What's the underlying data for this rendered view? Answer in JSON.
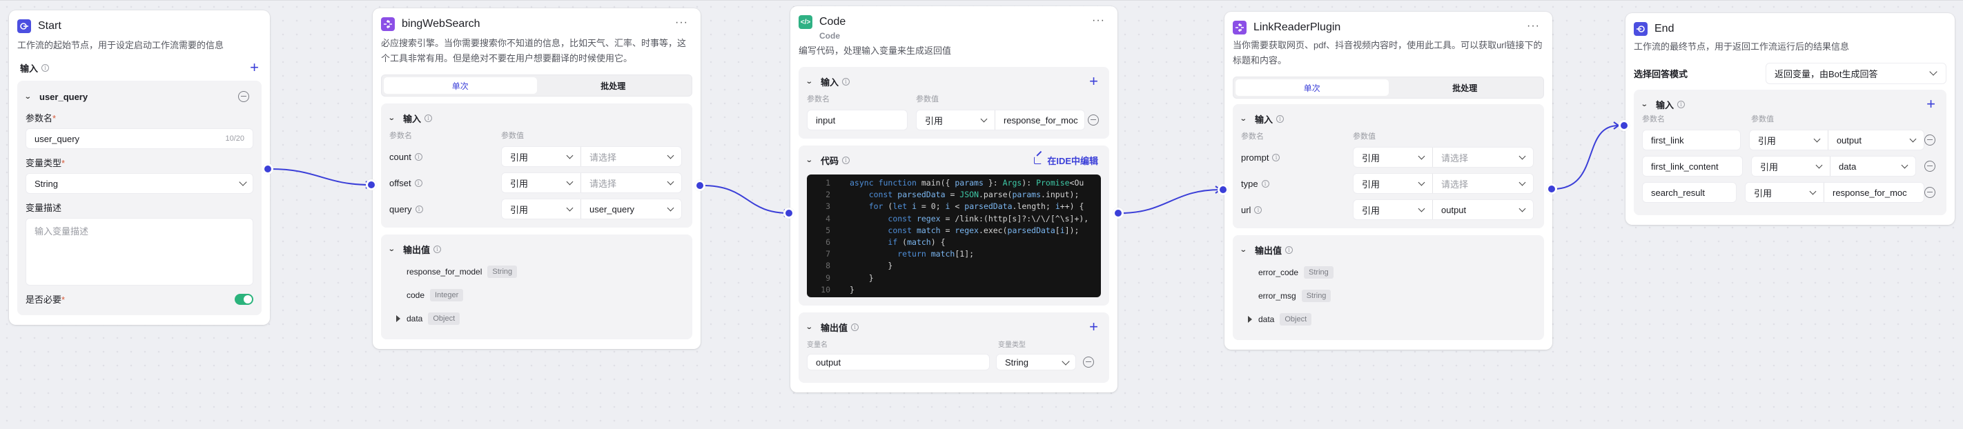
{
  "nodes": {
    "start": {
      "title": "Start",
      "description": "工作流的起始节点，用于设定启动工作流需要的信息",
      "input_label": "输入",
      "param": {
        "name": "user_query",
        "name_label": "参数名",
        "name_value": "user_query",
        "name_counter": "10/20",
        "type_label": "变量类型",
        "type_value": "String",
        "desc_label": "变量描述",
        "desc_placeholder": "输入变量描述",
        "required_label": "是否必要",
        "required": true
      }
    },
    "bing": {
      "title": "bingWebSearch",
      "description": "必应搜索引擎。当你需要搜索你不知道的信息，比如天气、汇率、时事等，这个工具非常有用。但是绝对不要在用户想要翻译的时候使用它。",
      "tabs": [
        "单次",
        "批处理"
      ],
      "active_tab": "单次",
      "input_label": "输入",
      "col_name": "参数名",
      "col_value": "参数值",
      "inputs": [
        {
          "name": "count",
          "mode": "引用",
          "value": "请选择",
          "placeholder": true
        },
        {
          "name": "offset",
          "mode": "引用",
          "value": "请选择",
          "placeholder": true
        },
        {
          "name": "query",
          "mode": "引用",
          "value": "user_query",
          "placeholder": false
        }
      ],
      "output_label": "输出值",
      "outputs": [
        {
          "name": "response_for_model",
          "type": "String",
          "expandable": false
        },
        {
          "name": "code",
          "type": "Integer",
          "expandable": false
        },
        {
          "name": "data",
          "type": "Object",
          "expandable": true
        }
      ]
    },
    "code": {
      "title": "Code",
      "subtitle": "Code",
      "description": "编写代码，处理输入变量来生成返回值",
      "input_label": "输入",
      "col_name": "参数名",
      "col_value": "参数值",
      "inputs": [
        {
          "name": "input",
          "mode": "引用",
          "value": "response_for_moc"
        }
      ],
      "code_label": "代码",
      "ide_link": "在IDE中编辑",
      "line_numbers": [
        "1",
        "2",
        "3",
        "4",
        "5",
        "6",
        "7",
        "8",
        "9",
        "10"
      ],
      "code_lines": [
        "async function main({ params }: Args): Promise<Ou",
        "    const parsedData = JSON.parse(params.input);",
        "    for (let i = 0; i < parsedData.length; i++) {",
        "        const regex = /link:(http[s]?:\\/\\/[^\\s]+),",
        "        const match = regex.exec(parsedData[i]);",
        "        if (match) {",
        "          return match[1];",
        "        }",
        "    }",
        "}"
      ],
      "output_label": "输出值",
      "out_col_name": "变量名",
      "out_col_type": "变量类型",
      "outputs": [
        {
          "name": "output",
          "type": "String"
        }
      ]
    },
    "linkreader": {
      "title": "LinkReaderPlugin",
      "description": "当你需要获取网页、pdf、抖音视频内容时，使用此工具。可以获取url链接下的标题和内容。",
      "tabs": [
        "单次",
        "批处理"
      ],
      "active_tab": "单次",
      "input_label": "输入",
      "col_name": "参数名",
      "col_value": "参数值",
      "inputs": [
        {
          "name": "prompt",
          "mode": "引用",
          "value": "请选择",
          "placeholder": true
        },
        {
          "name": "type",
          "mode": "引用",
          "value": "请选择",
          "placeholder": true
        },
        {
          "name": "url",
          "mode": "引用",
          "value": "output",
          "placeholder": false
        }
      ],
      "output_label": "输出值",
      "outputs": [
        {
          "name": "error_code",
          "type": "String",
          "expandable": false
        },
        {
          "name": "error_msg",
          "type": "String",
          "expandable": false
        },
        {
          "name": "data",
          "type": "Object",
          "expandable": true
        }
      ]
    },
    "end": {
      "title": "End",
      "description": "工作流的最终节点，用于返回工作流运行后的结果信息",
      "mode_label": "选择回答模式",
      "mode_value": "返回变量，由Bot生成回答",
      "input_label": "输入",
      "col_name": "参数名",
      "col_value": "参数值",
      "inputs": [
        {
          "name": "first_link",
          "mode": "引用",
          "value": "output"
        },
        {
          "name": "first_link_content",
          "mode": "引用",
          "value": "data"
        },
        {
          "name": "search_result",
          "mode": "引用",
          "value": "response_for_moc"
        }
      ]
    }
  },
  "colors": {
    "accent": "#3b3fd8",
    "start_icon": "#4c4fe0",
    "plugin_icon": "#8b4fe6",
    "code_icon": "#2fb184",
    "toggle_on": "#2bb37c"
  },
  "edges": [
    {
      "from": "Start",
      "to": "bingWebSearch"
    },
    {
      "from": "bingWebSearch",
      "to": "Code"
    },
    {
      "from": "Code",
      "to": "LinkReaderPlugin"
    },
    {
      "from": "LinkReaderPlugin",
      "to": "End"
    }
  ]
}
